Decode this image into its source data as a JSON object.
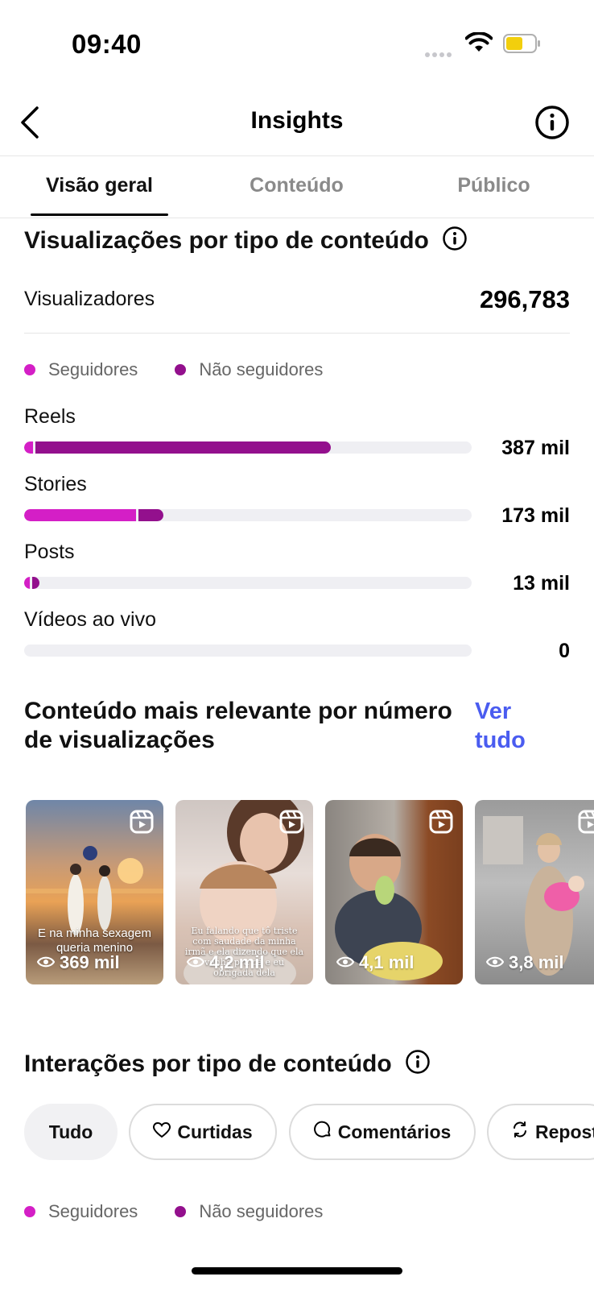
{
  "status_bar": {
    "time": "09:40"
  },
  "header": {
    "title": "Insights"
  },
  "tabs": [
    {
      "label": "Visão geral"
    },
    {
      "label": "Conteúdo"
    },
    {
      "label": "Público"
    }
  ],
  "views_section": {
    "title": "Visualizações por tipo de conteúdo",
    "viewers_label": "Visualizadores",
    "viewers_value": "296,783",
    "legend": [
      {
        "label": "Seguidores",
        "color": "#d41fc6"
      },
      {
        "label": "Não seguidores",
        "color": "#93108d"
      }
    ],
    "bars": [
      {
        "label": "Reels",
        "value": "387 mil",
        "followers_fraction": 0.02,
        "nonfollowers_fraction": 0.66
      },
      {
        "label": "Stories",
        "value": "173 mil",
        "followers_fraction": 0.25,
        "nonfollowers_fraction": 0.056
      },
      {
        "label": "Posts",
        "value": "13 mil",
        "followers_fraction": 0.012,
        "nonfollowers_fraction": 0.017
      },
      {
        "label": "Vídeos ao vivo",
        "value": "0",
        "followers_fraction": 0,
        "nonfollowers_fraction": 0
      }
    ]
  },
  "top_content": {
    "title": "Conteúdo mais relevante por número de visualizações",
    "see_all": "Ver tudo",
    "items": [
      {
        "views": "369 mil",
        "caption": "E na minha sexagem queria menino",
        "icon": "reel-icon"
      },
      {
        "views": "4,2 mil",
        "caption": "Eu falando que tô triste com saudade da minha irmã e ela dizendo que ela venha pra cá e eu obrigada dela",
        "icon": "reel-icon"
      },
      {
        "views": "4,1 mil",
        "caption": "",
        "icon": "reel-icon"
      },
      {
        "views": "3,8 mil",
        "caption": "",
        "icon": "reel-icon"
      }
    ]
  },
  "interactions": {
    "title": "Interações por tipo de conteúdo",
    "chips": [
      {
        "label": "Tudo",
        "icon": ""
      },
      {
        "label": "Curtidas",
        "icon": "heart-icon"
      },
      {
        "label": "Comentários",
        "icon": "comment-icon"
      },
      {
        "label": "Reposts",
        "icon": "repost-icon"
      }
    ],
    "legend": [
      {
        "label": "Seguidores",
        "color": "#d41fc6"
      },
      {
        "label": "Não seguidores",
        "color": "#93108d"
      }
    ]
  }
}
